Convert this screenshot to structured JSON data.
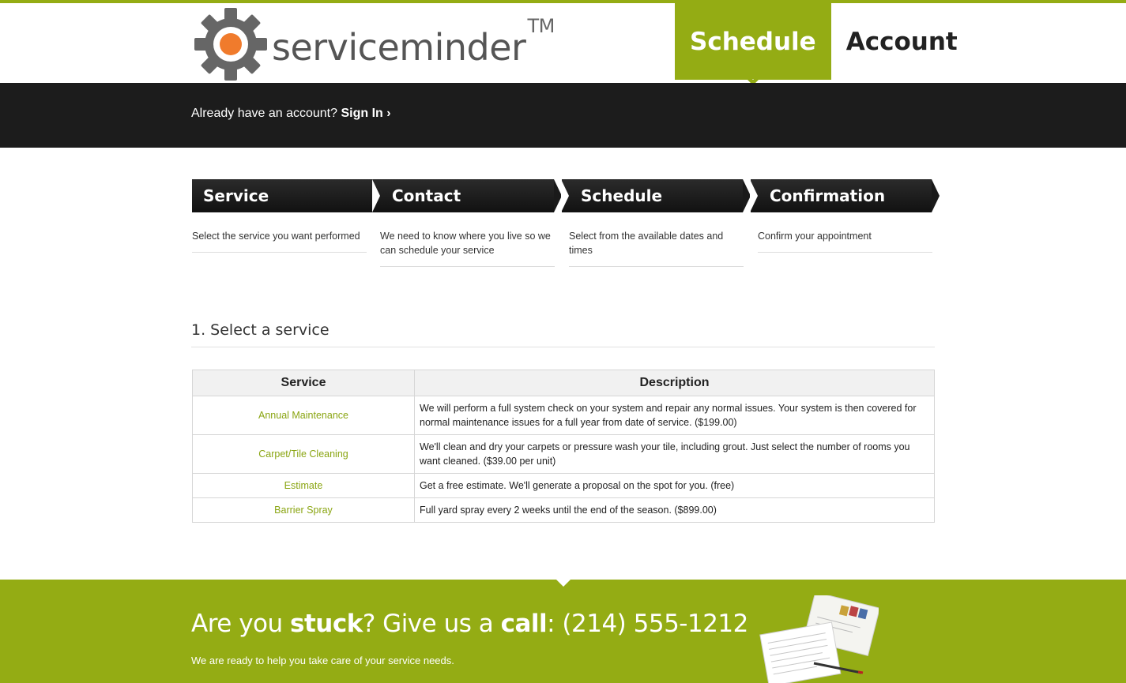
{
  "header": {
    "logo_text": "serviceminder",
    "logo_tm": "TM",
    "nav": [
      {
        "label": "Schedule",
        "active": true
      },
      {
        "label": "Account",
        "active": false
      }
    ]
  },
  "signin_bar": {
    "prompt": "Already have an account?",
    "link": "Sign In ›"
  },
  "steps": [
    {
      "title": "Service",
      "description": "Select the service you want performed"
    },
    {
      "title": "Contact",
      "description": "We need to know where you live so we can schedule your service"
    },
    {
      "title": "Schedule",
      "description": "Select from the available dates and times"
    },
    {
      "title": "Confirmation",
      "description": "Confirm your appointment"
    }
  ],
  "main": {
    "section_title": "1. Select a service",
    "table": {
      "columns": [
        "Service",
        "Description"
      ],
      "rows": [
        {
          "service": "Annual Maintenance",
          "description": "We will perform a full system check on your system and repair any normal issues. Your system is then covered for normal maintenance issues for a full year from date of service. ($199.00)"
        },
        {
          "service": "Carpet/Tile Cleaning",
          "description": "We'll clean and dry your carpets or pressure wash your tile, including grout. Just select the number of rooms you want cleaned. ($39.00 per unit)"
        },
        {
          "service": "Estimate",
          "description": "Get a free estimate. We'll generate a proposal on the spot for you. (free)"
        },
        {
          "service": "Barrier Spray",
          "description": "Full yard spray every 2 weeks until the end of the season. ($899.00)"
        }
      ]
    }
  },
  "footer": {
    "call_1": "Are you ",
    "call_2": "stuck",
    "call_3": "? Give us a ",
    "call_4": "call",
    "call_5": ": (214) 555-1212",
    "subtext": "We are ready to help you take care of your service needs."
  },
  "colors": {
    "brand_green": "#94ac14",
    "dark_bar": "#1c1c1c",
    "logo_orange": "#f07b2c"
  },
  "icons": [
    "gear-logo-icon",
    "papers-illustration"
  ]
}
